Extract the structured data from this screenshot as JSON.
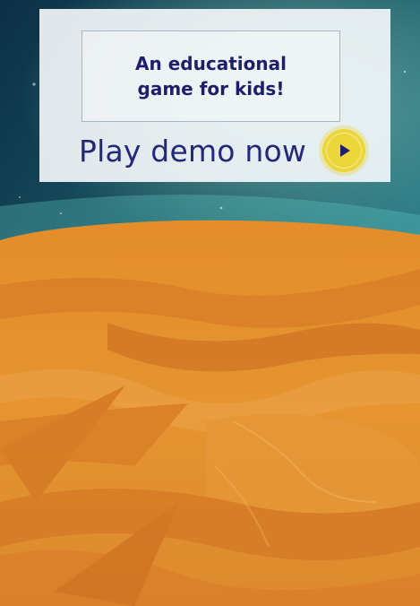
{
  "card": {
    "tagline": "An educational game for kids!",
    "play_label": "Play demo now"
  },
  "icons": {
    "play": "play-icon"
  },
  "colors": {
    "text_primary": "#1d1f6b",
    "accent": "#ecd63a",
    "planet": "#e08a2c",
    "sky": "#0f3f4d"
  }
}
